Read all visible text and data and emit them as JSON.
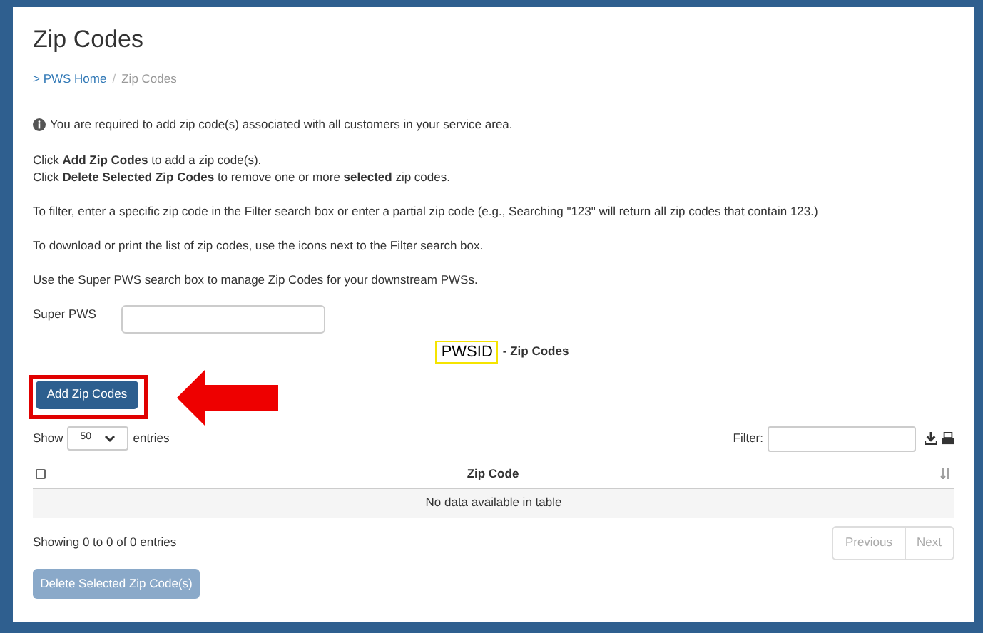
{
  "title": "Zip Codes",
  "breadcrumb_separator": "/",
  "breadcrumb": [
    {
      "label": "> PWS Home",
      "kind": "link"
    },
    {
      "label": "Zip Codes",
      "kind": "current"
    }
  ],
  "info": "You are required to add zip code(s) associated with all customers in your service area.",
  "instructions": [
    [
      "Click **Add Zip Codes** to add a zip code(s).",
      "Click **Delete Selected Zip Codes** to remove one or more **selected** zip codes."
    ],
    [
      "To filter, enter a specific zip code in the Filter search box or enter a partial zip code (e.g., Searching \"123\" will return all zip codes that contain 123.)"
    ],
    [
      "To download or print the list of zip codes, use the icons next to the Filter search box."
    ],
    [
      "Use the Super PWS search box to manage Zip Codes for your downstream PWSs."
    ]
  ],
  "super_pws": {
    "label": "Super PWS"
  },
  "table_title": {
    "id": "PWSID",
    "suffix": "- Zip Codes"
  },
  "add_button": {
    "label": "Add Zip Codes"
  },
  "length": {
    "show": "Show",
    "value": "50",
    "entries": "entries"
  },
  "filter": {
    "label": "Filter:"
  },
  "table": {
    "select_all_checked": false,
    "columns": [
      "Zip Code"
    ],
    "empty": "No data available in table"
  },
  "info_text": "Showing 0 to 0 of 0 entries",
  "pagination": [
    {
      "label": "Previous",
      "disabled": true
    },
    {
      "label": "Next",
      "disabled": true
    }
  ],
  "delete_button": {
    "label": "Delete Selected Zip Code(s)",
    "disabled": true
  }
}
